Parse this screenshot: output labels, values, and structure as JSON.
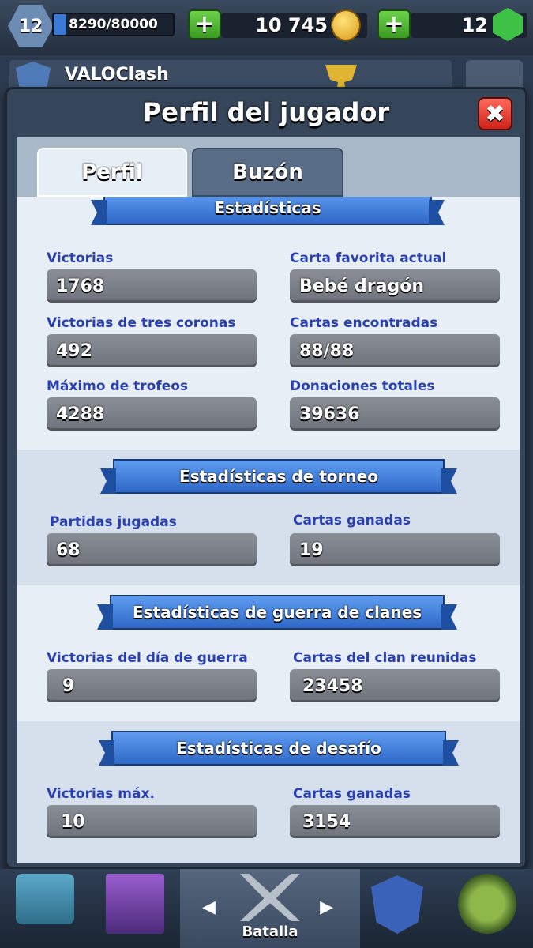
{
  "topbar": {
    "level": "12",
    "xp": "8290/80000",
    "xp_progress": 0.104,
    "gold": "10 745",
    "gems": "12",
    "add_gold_label": "+",
    "add_gems_label": "+"
  },
  "clan_row": {
    "name": "VALOClash"
  },
  "modal": {
    "title": "Perfil del jugador",
    "close_label": "✖",
    "tabs": [
      {
        "label": "Perfil",
        "active": true
      },
      {
        "label": "Buzón",
        "active": false
      }
    ]
  },
  "sections": {
    "stats": {
      "title": "Estadísticas",
      "items": [
        {
          "label": "Victorias",
          "value": "1768"
        },
        {
          "label": "Carta favorita actual",
          "value": "Bebé dragón"
        },
        {
          "label": "Victorias de tres coronas",
          "value": "492"
        },
        {
          "label": "Cartas encontradas",
          "value": "88/88"
        },
        {
          "label": "Máximo de trofeos",
          "value": "4288"
        },
        {
          "label": "Donaciones totales",
          "value": "39636"
        }
      ]
    },
    "tournament": {
      "title": "Estadísticas de torneo",
      "items": [
        {
          "label": "Partidas jugadas",
          "value": "68"
        },
        {
          "label": "Cartas ganadas",
          "value": "19"
        }
      ]
    },
    "clan_war": {
      "title": "Estadísticas de guerra de clanes",
      "items": [
        {
          "label": "Victorias del día de guerra",
          "value": "9"
        },
        {
          "label": "Cartas del clan reunidas",
          "value": "23458"
        }
      ]
    },
    "challenge": {
      "title": "Estadísticas de desafío",
      "items": [
        {
          "label": "Victorias máx.",
          "value": "10"
        },
        {
          "label": "Cartas ganadas",
          "value": "3154"
        }
      ]
    }
  },
  "bottom_nav": {
    "battle_label": "Batalla",
    "arrow_left": "◀",
    "arrow_right": "▶",
    "icons": [
      "chest-icon",
      "cards-icon",
      "swords-icon",
      "clan-icon",
      "events-icon"
    ]
  },
  "colors": {
    "label_blue": "#2a3fb0",
    "ribbon_blue": "#2f68c8",
    "close_red": "#d0221a",
    "plus_green": "#3c9a22"
  }
}
